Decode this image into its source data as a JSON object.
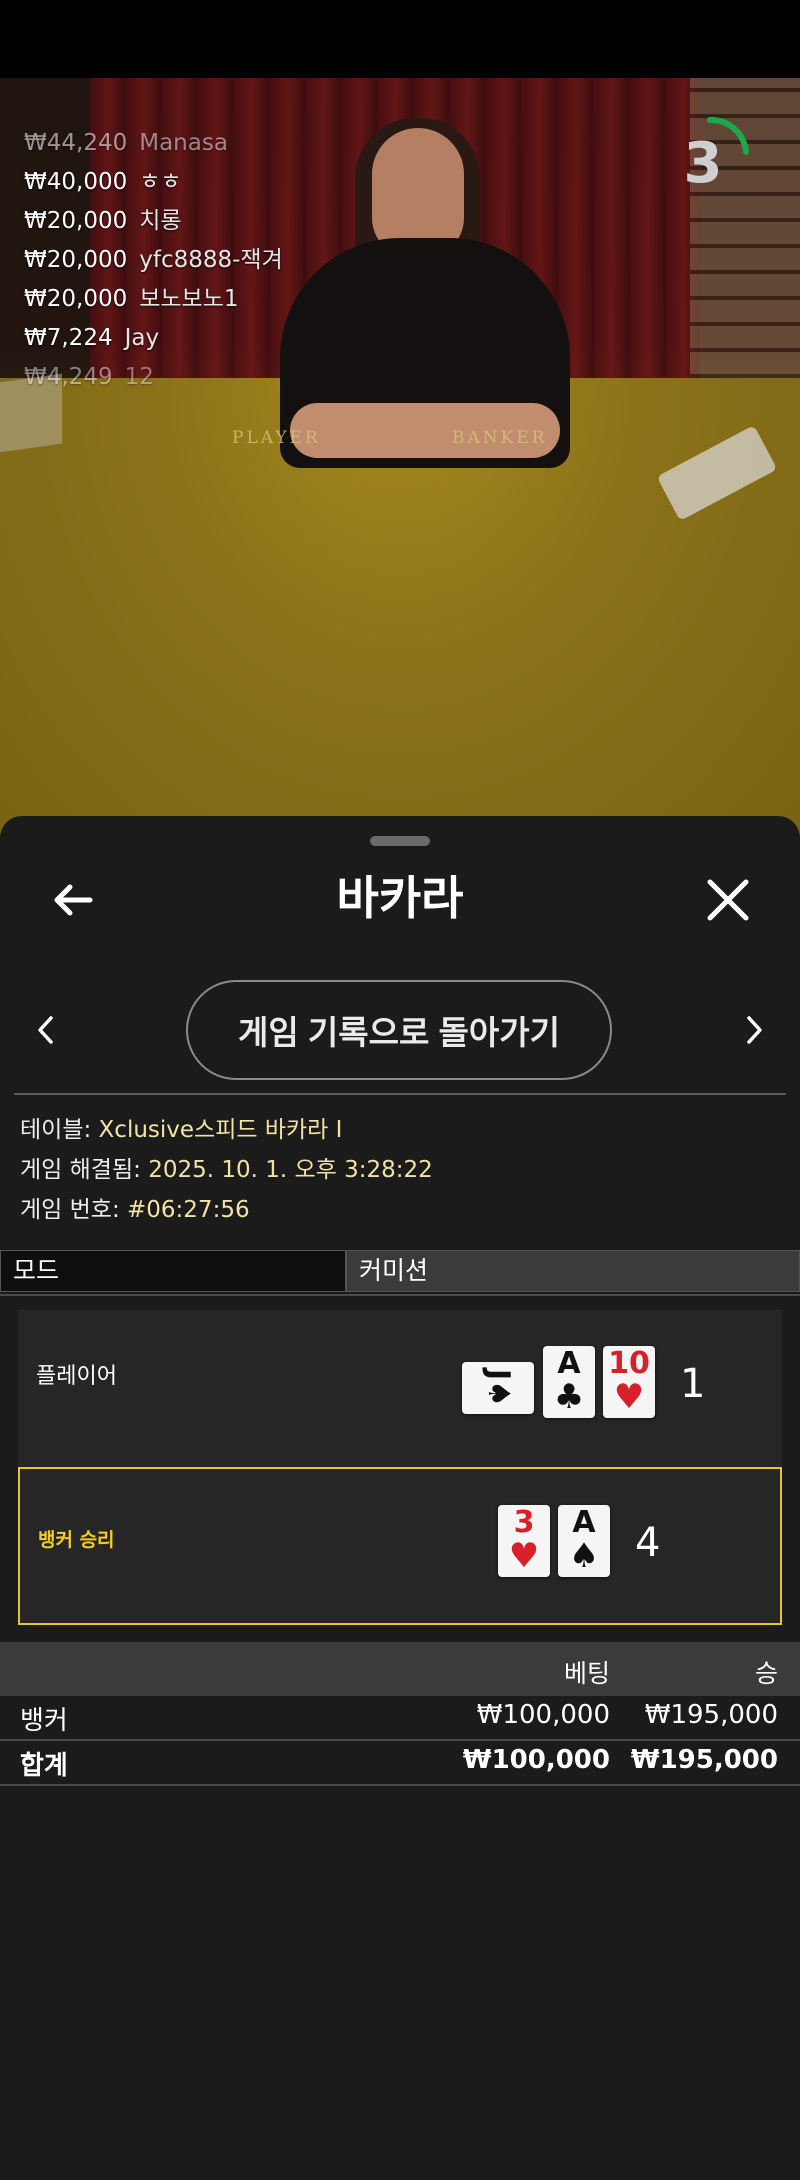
{
  "live_bets": [
    {
      "amount": "₩44,240",
      "name": "Manasa"
    },
    {
      "amount": "₩40,000",
      "name": "ㅎㅎ"
    },
    {
      "amount": "₩20,000",
      "name": "치롱"
    },
    {
      "amount": "₩20,000",
      "name": "yfc8888-잭겨"
    },
    {
      "amount": "₩20,000",
      "name": "보노보노1"
    },
    {
      "amount": "₩7,224",
      "name": "Jay"
    },
    {
      "amount": "₩4,249",
      "name": "12"
    }
  ],
  "table_felt": {
    "player": "PLAYER",
    "banker": "BANKER"
  },
  "countdown": {
    "value": "3",
    "color": "#1ea84c"
  },
  "sheet": {
    "title": "바카라",
    "back_icon": "arrow-left-icon",
    "close_icon": "close-icon",
    "history_button": "게임 기록으로 돌아가기",
    "prev_icon": "chevron-left-icon",
    "next_icon": "chevron-right-icon"
  },
  "details": {
    "table_label": "테이블:",
    "table_value": "Xclusive스피드 바카라 I",
    "resolved_label": "게임 해결됨:",
    "resolved_value": "2025. 10. 1. 오후 3:28:22",
    "number_label": "게임 번호:",
    "number_value": "#06:27:56"
  },
  "mode": {
    "label": "모드",
    "value": "커미션"
  },
  "hands": {
    "player": {
      "label": "플레이어",
      "score": "1",
      "cards": [
        {
          "rank": "J",
          "suit": "♠",
          "color": "black",
          "orientation": "sideways"
        },
        {
          "rank": "A",
          "suit": "♣",
          "color": "black"
        },
        {
          "rank": "10",
          "suit": "♥",
          "color": "red"
        }
      ]
    },
    "banker": {
      "label": "뱅커 승리",
      "score": "4",
      "cards": [
        {
          "rank": "3",
          "suit": "♥",
          "color": "red"
        },
        {
          "rank": "A",
          "suit": "♠",
          "color": "black"
        }
      ]
    }
  },
  "results": {
    "header_bet": "베팅",
    "header_win": "승",
    "rows": [
      {
        "name": "뱅커",
        "bet": "₩100,000",
        "win": "₩195,000"
      },
      {
        "name": "합계",
        "bet": "₩100,000",
        "win": "₩195,000"
      }
    ]
  },
  "colors": {
    "accent_gold": "#f3cd23",
    "win_border": "#e4c52b",
    "info_value": "#f2e3a5",
    "sheet_bg": "#1b1b1b"
  }
}
